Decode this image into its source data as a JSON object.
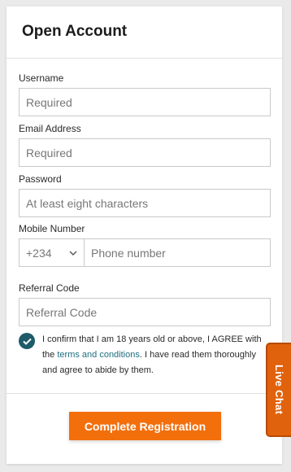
{
  "form": {
    "title": "Open Account",
    "username": {
      "label": "Username",
      "placeholder": "Required"
    },
    "email": {
      "label": "Email Address",
      "placeholder": "Required"
    },
    "password": {
      "label": "Password",
      "placeholder": "At least eight characters"
    },
    "mobile": {
      "label": "Mobile Number",
      "country_code": "+234",
      "placeholder": "Phone number"
    },
    "referral": {
      "label": "Referral Code",
      "placeholder": "Referral Code"
    },
    "confirm": {
      "checked": true,
      "text_before": "I confirm that I am 18 years old or above, I AGREE with the ",
      "link_text": "terms and conditions",
      "text_after": ". I have read them thoroughly and agree to abide by them."
    },
    "submit_label": "Complete Registration"
  },
  "live_chat": {
    "label": "Live Chat"
  },
  "colors": {
    "accent": "#f26f0c",
    "check": "#1d5b69",
    "link": "#1f6f80"
  },
  "icons": {
    "dropdown": "chevron-down-icon",
    "checkbox": "check-icon"
  }
}
